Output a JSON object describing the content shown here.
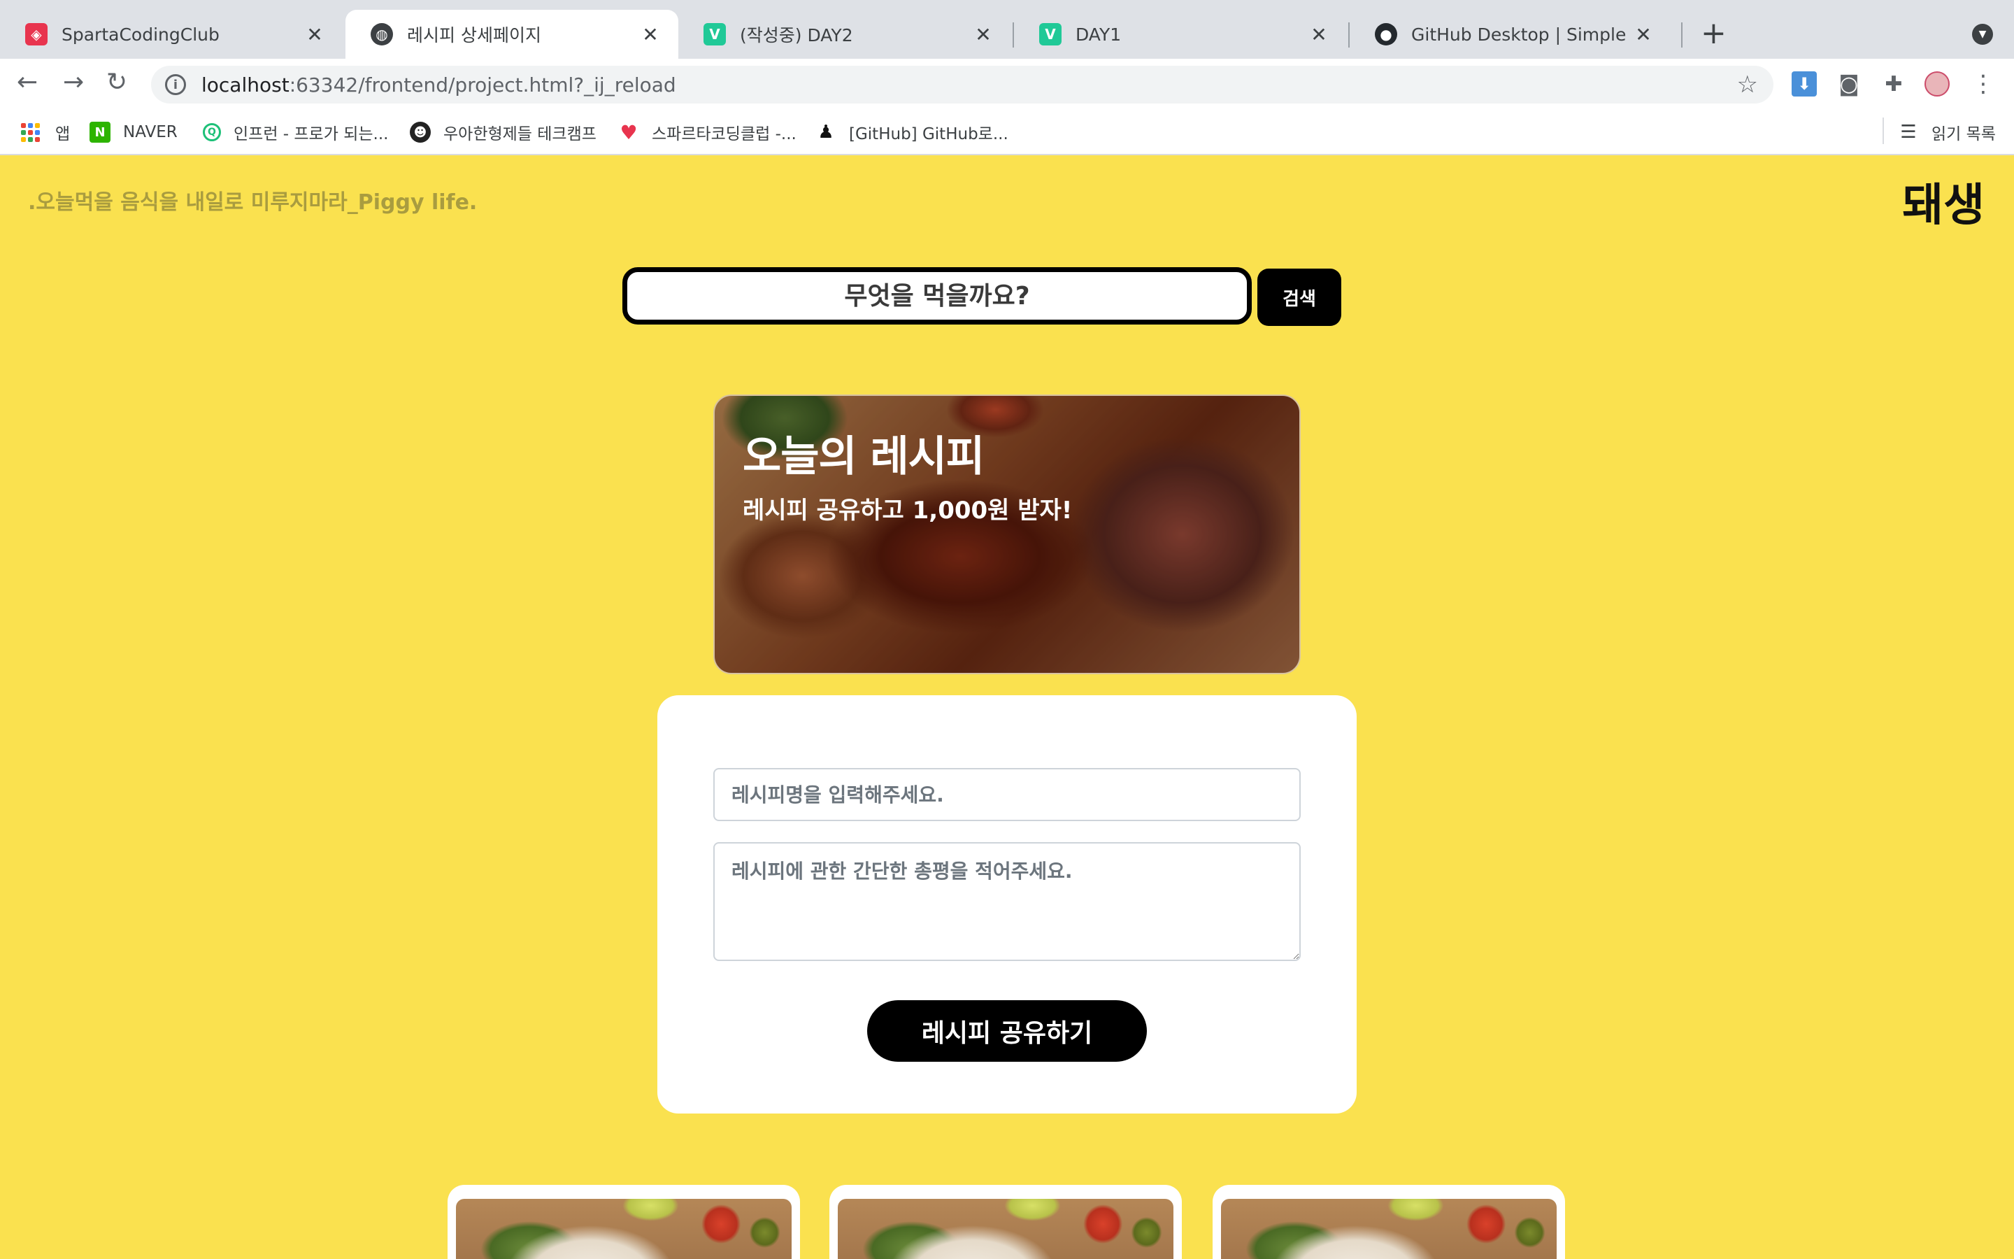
{
  "browser": {
    "tabs": [
      {
        "title": "SpartaCodingClub",
        "favicon": "sparta-icon",
        "active": false
      },
      {
        "title": "레시피 상세페이지",
        "favicon": "globe-icon",
        "active": true
      },
      {
        "title": "(작성중) DAY2",
        "favicon": "velog-icon",
        "active": false
      },
      {
        "title": "DAY1",
        "favicon": "velog-icon",
        "active": false
      },
      {
        "title": "GitHub Desktop | Simple collab",
        "favicon": "github-icon",
        "active": false
      }
    ],
    "url": {
      "host": "localhost",
      "rest": ":63342/frontend/project.html?_ij_reload"
    },
    "bookmarks": [
      {
        "label": "앱",
        "icon": "apps-icon"
      },
      {
        "label": "NAVER",
        "icon": "naver-icon"
      },
      {
        "label": "인프런 - 프로가 되는...",
        "icon": "inflearn-icon"
      },
      {
        "label": "우아한형제들 테크캠프",
        "icon": "woowahan-icon"
      },
      {
        "label": "스파르타코딩클럽 -...",
        "icon": "sparta-bookmark-icon"
      },
      {
        "label": "[GitHub] GitHub로...",
        "icon": "penguin-icon"
      }
    ],
    "reading_list": "읽기 목록"
  },
  "header": {
    "slogan": ".오늘먹을 음식을 내일로 미루지마라_Piggy life.",
    "brand": "돼생"
  },
  "search": {
    "placeholder": "무엇을 먹을까요?",
    "button": "검색"
  },
  "hero": {
    "title": "오늘의 레시피",
    "subtitle": "레시피 공유하고 1,000원 받자!"
  },
  "form": {
    "title_placeholder": "레시피명을 입력해주세요.",
    "desc_placeholder": "레시피에 관한 간단한 총평을 적어주세요.",
    "submit": "레시피 공유하기"
  },
  "colors": {
    "page_bg": "#fae14f",
    "button_bg": "#000000",
    "card_bg": "#ffffff"
  }
}
